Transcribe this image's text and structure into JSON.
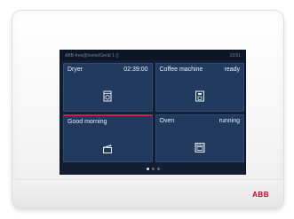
{
  "status_bar": {
    "location": "ABB-free@home/Gerät 1 ()",
    "time": "13:51"
  },
  "tiles": [
    {
      "title": "Dryer",
      "status": "02:39:00",
      "icon": "dryer-icon",
      "active": false
    },
    {
      "title": "Coffee machine",
      "status": "ready",
      "icon": "coffee-machine-icon",
      "active": false
    },
    {
      "title": "Good morning",
      "status": "",
      "icon": "scene-clapperboard-icon",
      "active": true
    },
    {
      "title": "Oven",
      "status": "running",
      "icon": "oven-icon",
      "active": false
    }
  ],
  "pager": {
    "pages": 3,
    "current": 1
  },
  "brand": {
    "logo_text": "ABB",
    "color": "#c00418"
  },
  "colors": {
    "screen_bg": "#121e32",
    "tile_bg": "#233a5f",
    "accent": "#d01b4c"
  }
}
